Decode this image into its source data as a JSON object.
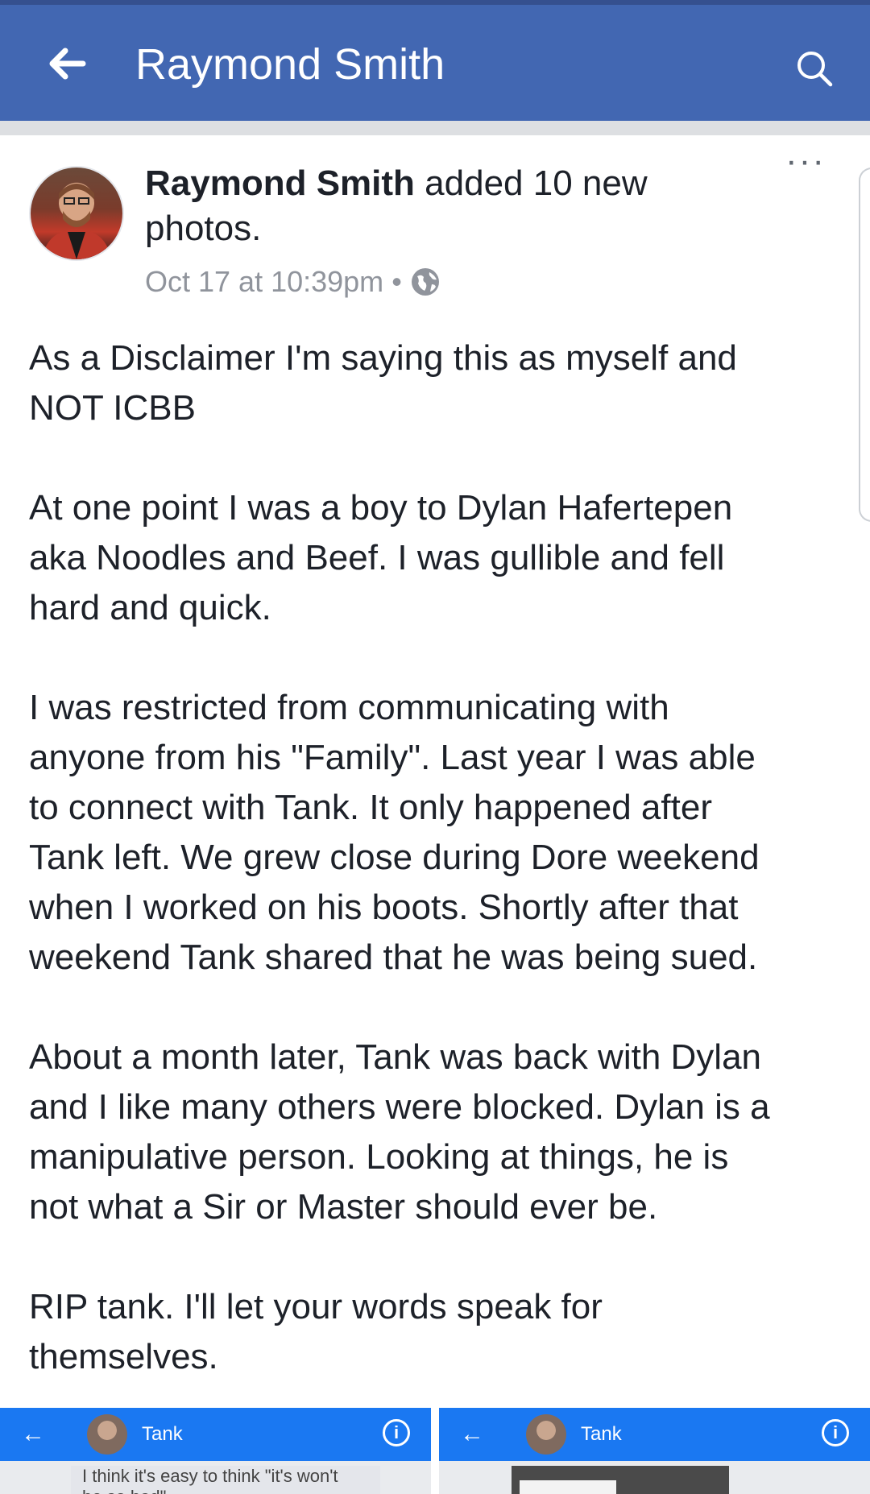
{
  "header": {
    "title": "Raymond Smith",
    "back_icon": "arrow-left-icon",
    "search_icon": "search-icon",
    "background_color": "#4267b2"
  },
  "post": {
    "author": "Raymond Smith",
    "action": "added 10 new photos.",
    "timestamp": "Oct 17 at 10:39pm",
    "separator": "•",
    "privacy_icon": "globe-icon",
    "more_label": "···",
    "body": [
      "As a Disclaimer I'm saying this as myself and\nNOT ICBB",
      "At one point I was a boy to Dylan Hafertepen\naka Noodles and Beef.  I was gullible and fell\nhard and quick.",
      "I was restricted from communicating with\nanyone from his \"Family\".  Last year I was able\nto connect with Tank. It only happened after\nTank left.  We grew close during Dore weekend\nwhen I worked on his boots.  Shortly after that\nweekend Tank shared that he was being sued.",
      "About a month later, Tank was back with Dylan\nand I like many others were blocked.  Dylan is a\nmanipulative person. Looking at things, he is\nnot what a Sir or Master should ever be.",
      "RIP tank.  I'll let your words speak for\nthemselves."
    ]
  },
  "photos": [
    {
      "name": "Tank",
      "back_label": "←",
      "info_label": "i",
      "message": "I think it's easy to think \"it's won't\nbe so bad\""
    },
    {
      "name": "Tank",
      "back_label": "←",
      "info_label": "i"
    }
  ]
}
